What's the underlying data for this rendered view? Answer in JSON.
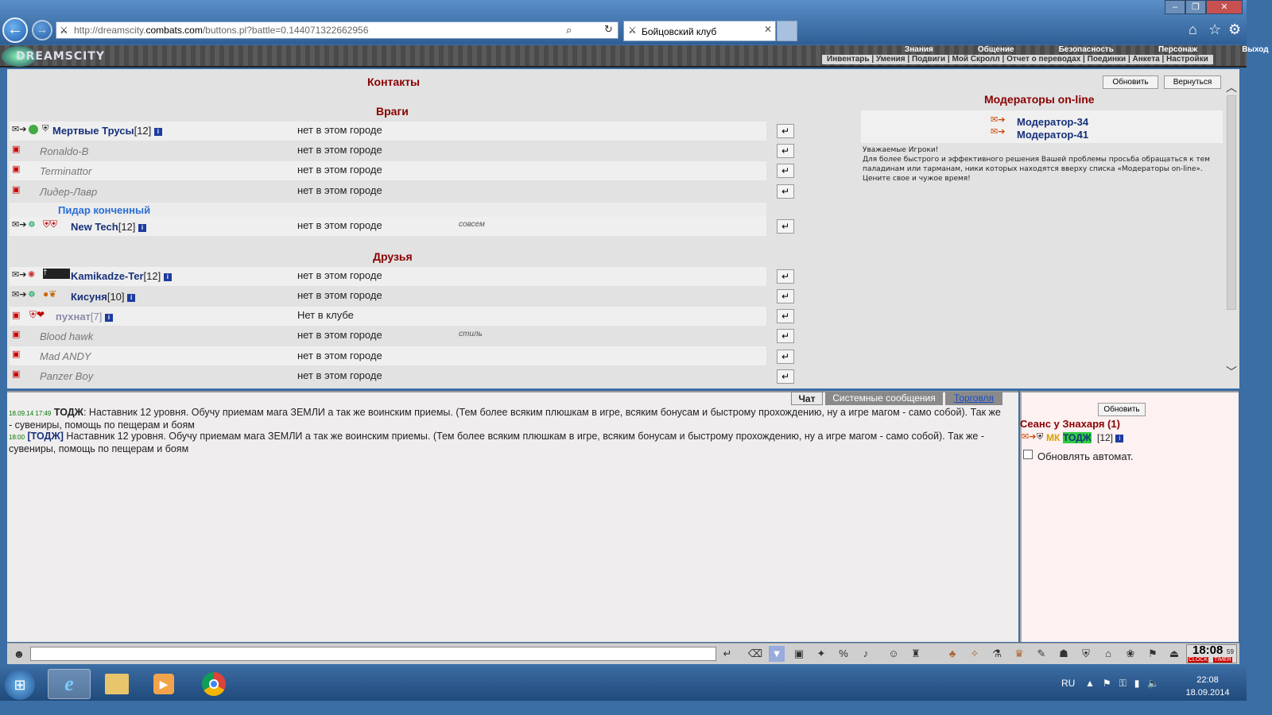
{
  "browser": {
    "url_prefix": "http://dreamscity.",
    "url_domain": "combats.com",
    "url_suffix": "/buttons.pl?battle=0.144071322662956",
    "tab_title": "Бойцовский клуб",
    "window_controls": [
      "–",
      "❐",
      "✕"
    ]
  },
  "game": {
    "logo": "DREAMSCITY",
    "menu_top": [
      "Знания",
      "Общение",
      "Безопасность",
      "Персонаж",
      "Выход"
    ],
    "menu_sub": "Инвентарь | Умения | Подвиги | Мой Скролл | Отчет о переводах | Поединки | Анкета | Настройки"
  },
  "contacts": {
    "title": "Контакты",
    "refresh": "Обновить",
    "back": "Вернуться",
    "enemies_title": "Враги",
    "enemies": [
      {
        "name": "Мертвые Трусы",
        "level": "[12]",
        "status": "нет в этом городе",
        "online": true,
        "note": ""
      },
      {
        "name": "Ronaldo-B",
        "level": "",
        "status": "нет в этом городе",
        "online": false,
        "note": ""
      },
      {
        "name": "Terminattor",
        "level": "",
        "status": "нет в этом городе",
        "online": false,
        "note": ""
      },
      {
        "name": "Лидер-Лавр",
        "level": "",
        "status": "нет в этом городе",
        "online": false,
        "note": ""
      }
    ],
    "group_title": "Пидар конченный",
    "group": [
      {
        "name": "New Tech",
        "level": "[12]",
        "status": "нет в этом городе",
        "online": true,
        "note": "совсем"
      }
    ],
    "friends_title": "Друзья",
    "friends": [
      {
        "name": "Kamikadze-Ter",
        "level": "[12]",
        "status": "нет в этом городе",
        "online": true,
        "note": ""
      },
      {
        "name": "Кисуня",
        "level": "[10]",
        "status": "нет в этом городе",
        "online": true,
        "note": ""
      },
      {
        "name": "пухнат",
        "level": "[7]",
        "status": "Нет в клубе",
        "online": true,
        "note": ""
      },
      {
        "name": "Blood hawk",
        "level": "",
        "status": "нет в этом городе",
        "online": false,
        "note": "стиль"
      },
      {
        "name": "Mad ANDY",
        "level": "",
        "status": "нет в этом городе",
        "online": false,
        "note": ""
      },
      {
        "name": "Panzer Boy",
        "level": "",
        "status": "нет в этом городе",
        "online": false,
        "note": ""
      }
    ],
    "offline_badge": "НЕТ В КЛУБЕ"
  },
  "moderators": {
    "title": "Модераторы on-line",
    "list": [
      "Модератор-34",
      "Модератор-41"
    ],
    "notice_1": "Уважаемые Игроки!",
    "notice_2": "Для более быстрого и эффективного решения Вашей проблемы просьба обращаться к тем паладинам или тарманам, ники которых находятся вверху списка «Модераторы on-line».",
    "notice_3": "Цените свое и чужое время!"
  },
  "chat": {
    "tabs": [
      "Чат",
      "Системные сообщения",
      "Торговля"
    ],
    "messages": [
      {
        "time": "18.09.14 17:49",
        "author": "ТОДЖ",
        "text": ": Наставник 12 уровня. Обучу приемам мага ЗЕМЛИ а так же воинским приемы. (Тем более всяким плюшкам в игре, всяким бонусам и быстрому прохождению, ну а игре магом - само собой). Так же - сувениры, помощь по пещерам и боям"
      },
      {
        "time": "18:00",
        "author": "[ТОДЖ]",
        "text": " Наставник 12 уровня. Обучу приемам мага ЗЕМЛИ а так же воинским приемы. (Тем более всяким плюшкам в игре, всяким бонусам и быстрому прохождению, ну а игре магом - само собой). Так же - сувениры, помощь по пещерам и боям"
      }
    ]
  },
  "room": {
    "refresh": "Обновить",
    "title": "Сеанс у Знахаря (1)",
    "user_clan": "МК",
    "user_name": "ТОДЖ",
    "user_level": "[12]",
    "auto_refresh": "Обновлять автомат."
  },
  "toolbar": {
    "clock": "18:08",
    "clock_seconds": "59",
    "clock_label": "CLOCK",
    "timer_label": "TIMER"
  },
  "taskbar": {
    "lang": "RU",
    "time": "22:08",
    "date": "18.09.2014"
  }
}
